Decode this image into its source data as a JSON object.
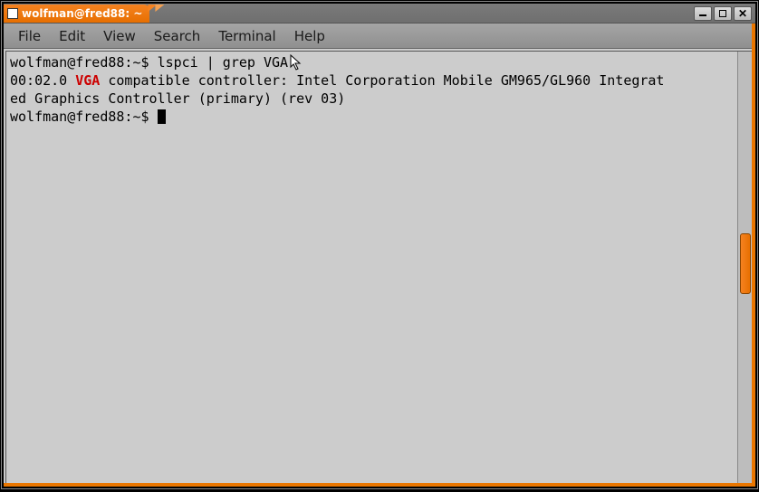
{
  "window": {
    "title": "wolfman@fred88: ~"
  },
  "menu": {
    "file": "File",
    "edit": "Edit",
    "view": "View",
    "search": "Search",
    "terminal": "Terminal",
    "help": "Help"
  },
  "terminal": {
    "prompt": "wolfman@fred88:~$",
    "command1": "lspci | grep VGA",
    "output_line1_pre": "00:02.0 ",
    "output_line1_match": "VGA",
    "output_line1_post": " compatible controller: Intel Corporation Mobile GM965/GL960 Integrat",
    "output_line2": "ed Graphics Controller (primary) (rev 03)"
  }
}
